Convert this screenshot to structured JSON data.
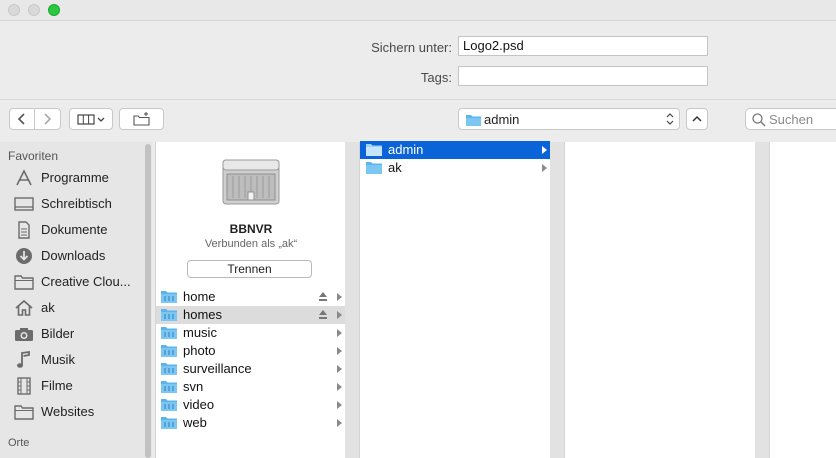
{
  "window": {
    "traffic_lights": [
      "close",
      "minimize",
      "zoom"
    ]
  },
  "save": {
    "save_as_label": "Sichern unter:",
    "filename": "Logo2.psd",
    "tags_label": "Tags:",
    "tags_value": ""
  },
  "toolbar": {
    "location": "admin",
    "search_placeholder": "Suchen"
  },
  "sidebar": {
    "favorites_heading": "Favoriten",
    "places_heading": "Orte",
    "items": [
      {
        "label": "Programme",
        "icon": "applications-icon"
      },
      {
        "label": "Schreibtisch",
        "icon": "desktop-icon"
      },
      {
        "label": "Dokumente",
        "icon": "documents-icon"
      },
      {
        "label": "Downloads",
        "icon": "downloads-icon"
      },
      {
        "label": "Creative Clou...",
        "icon": "folder-icon"
      },
      {
        "label": "ak",
        "icon": "home-icon"
      },
      {
        "label": "Bilder",
        "icon": "camera-icon"
      },
      {
        "label": "Musik",
        "icon": "music-icon"
      },
      {
        "label": "Filme",
        "icon": "film-icon"
      },
      {
        "label": "Websites",
        "icon": "folder-icon"
      }
    ]
  },
  "server": {
    "name": "BBNVR",
    "connected_as": "Verbunden als „ak“",
    "disconnect_label": "Trennen",
    "shares": [
      {
        "label": "home",
        "ejectable": true
      },
      {
        "label": "homes",
        "ejectable": true,
        "selected": true
      },
      {
        "label": "music",
        "ejectable": false
      },
      {
        "label": "photo",
        "ejectable": false
      },
      {
        "label": "surveillance",
        "ejectable": false
      },
      {
        "label": "svn",
        "ejectable": false
      },
      {
        "label": "video",
        "ejectable": false
      },
      {
        "label": "web",
        "ejectable": false
      }
    ]
  },
  "column2": {
    "items": [
      {
        "label": "admin",
        "selected": true
      },
      {
        "label": "ak",
        "selected": false
      }
    ]
  },
  "colors": {
    "selection_blue": "#0a63d7",
    "folder_blue": "#5bb4ec",
    "zoom_green": "#28c840"
  }
}
